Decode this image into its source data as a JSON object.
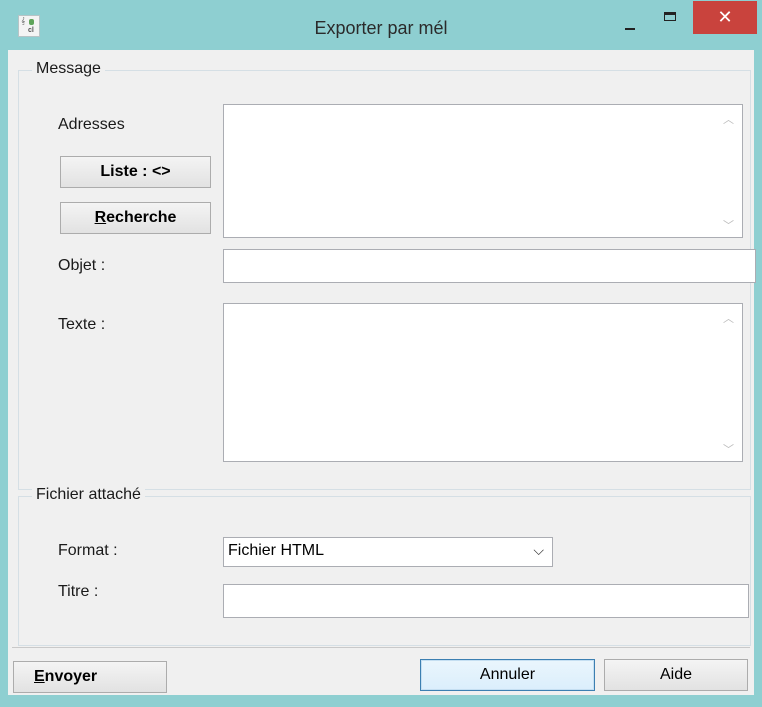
{
  "window": {
    "title": "Exporter par mél",
    "icons": {
      "app": "app-icon",
      "minimize": "minimize-icon",
      "maximize": "maximize-icon",
      "close": "close-icon"
    },
    "close_glyph": "✕"
  },
  "message": {
    "group_label": "Message",
    "adresses_label": "Adresses",
    "liste_button": "Liste : <>",
    "recherche_button": {
      "accel": "R",
      "rest": "echerche"
    },
    "objet_label": "Objet :",
    "texte_label": "Texte :"
  },
  "attachment": {
    "group_label": "Fichier attaché",
    "format_label": "Format :",
    "format_value": "Fichier HTML",
    "titre_label": "Titre :"
  },
  "buttons": {
    "envoyer": {
      "accel": "E",
      "rest": "nvoyer"
    },
    "annuler": "Annuler",
    "aide": "Aide"
  },
  "colors": {
    "title_bar": "#8ecfd1",
    "close": "#c9433d",
    "client": "#f0f0f0"
  }
}
